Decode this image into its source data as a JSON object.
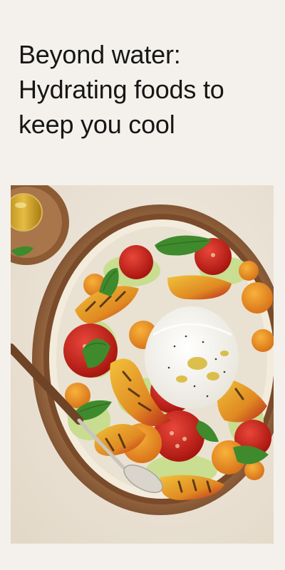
{
  "article": {
    "title": "Beyond water: Hydrating foods to keep you cool"
  },
  "hero_image": {
    "subject": "salad-bowl-with-burrata-grilled-peaches-tomatoes-basil"
  },
  "colors": {
    "page_background": "#f4f1ec",
    "headline_text": "#161616",
    "tabletop": "#ece5d9",
    "bowl_wood": "#8a5a34",
    "plate_cream": "#f3ecdd",
    "tomato_red": "#c9231c",
    "tomato_orange": "#e8901f",
    "basil_green": "#3f8a2c",
    "burrata_white": "#f7f5ef"
  }
}
